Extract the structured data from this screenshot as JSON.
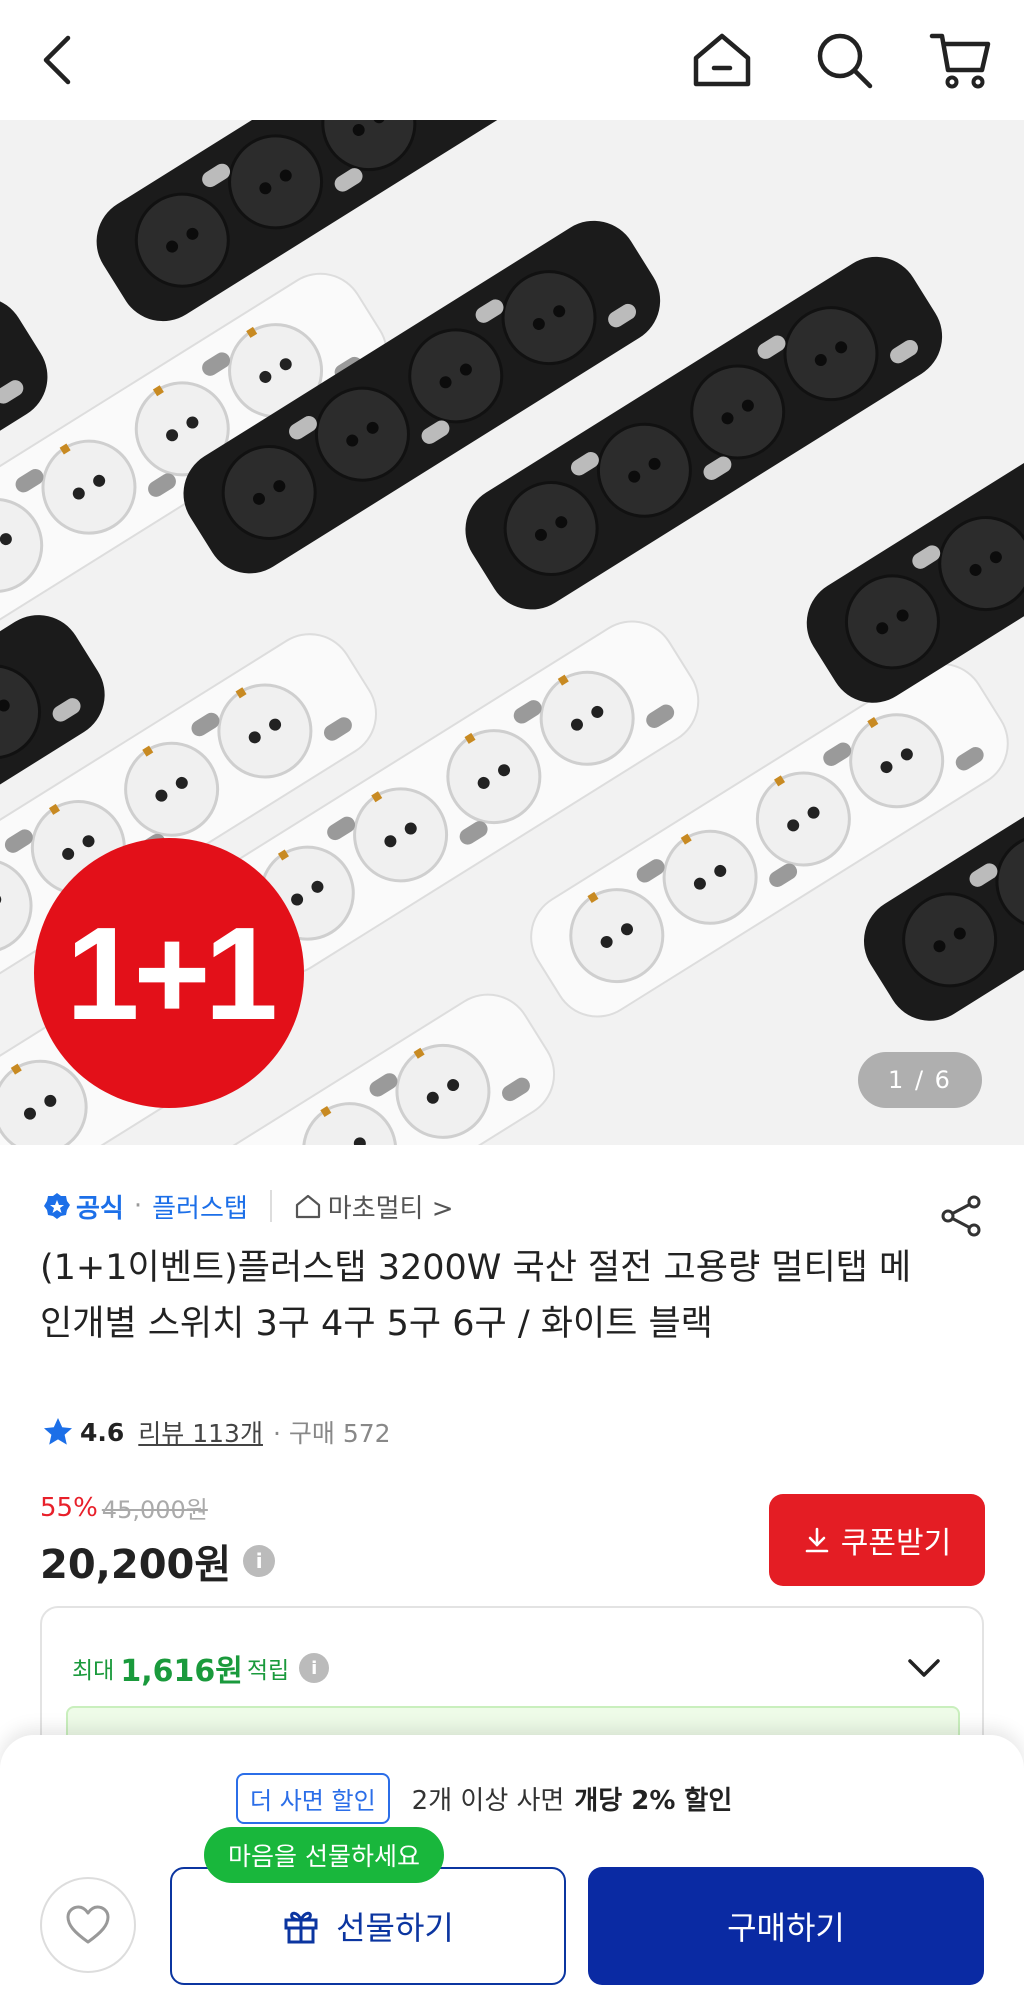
{
  "header": {
    "back_icon": "chevron-left-icon",
    "home_icon": "home-icon",
    "search_icon": "search-icon",
    "cart_icon": "cart-icon"
  },
  "hero": {
    "badge_text": "1+1",
    "counter": "1 / 6"
  },
  "seller": {
    "official_label": "공식",
    "brand": "플러스탭",
    "shop": "마초멀티 >",
    "share_icon": "share-icon"
  },
  "product": {
    "title": "(1+1이벤트)플러스탭 3200W 국산 절전 고용량 멀티탭 메인개별 스위치 3구 4구 5구 6구 / 화이트 블랙",
    "rating": "4.6",
    "reviews": "리뷰 113개",
    "purchases": "구매 572"
  },
  "price": {
    "discount_pct": "55%",
    "original": "45,000원",
    "final": "20,200원",
    "coupon_button": "쿠폰받기"
  },
  "points": {
    "prefix": "최대",
    "amount": "1,616원",
    "suffix": "적립"
  },
  "bottom": {
    "promo_tag": "더 사면 할인",
    "promo_text": "2개 이상 사면",
    "promo_strong": "개당 2% 할인",
    "gift_tooltip": "마음을 선물하세요",
    "gift_button": "선물하기",
    "buy_button": "구매하기"
  },
  "colors": {
    "accent_blue": "#1c6fe8",
    "buy_navy": "#0a2aa3",
    "coupon_red": "#e41d24",
    "discount_red": "#e8202a",
    "points_green": "#1a9a3c",
    "tooltip_green": "#19b73c"
  }
}
